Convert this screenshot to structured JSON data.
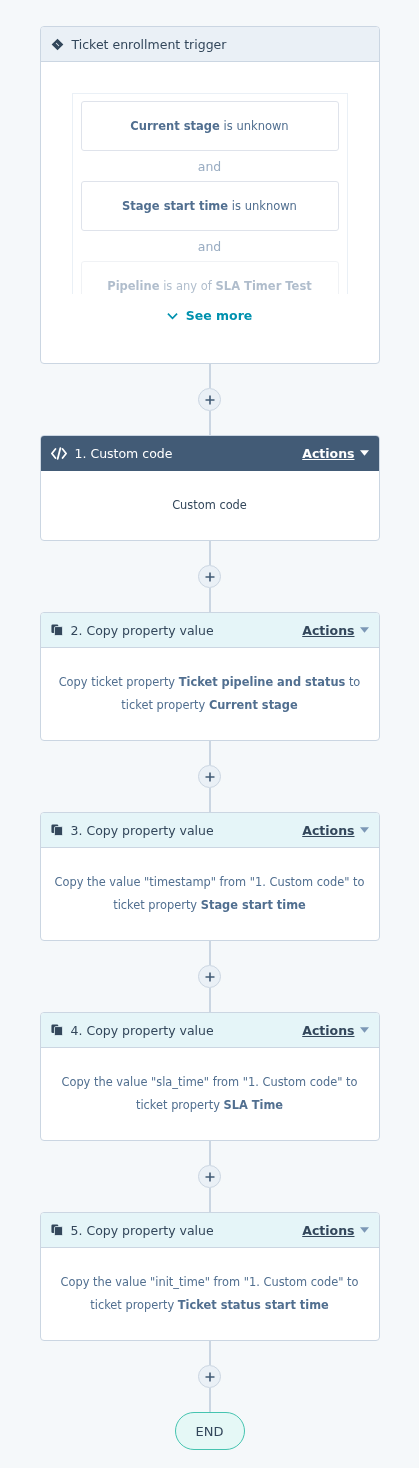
{
  "trigger": {
    "title": "Ticket enrollment trigger",
    "conditions": [
      {
        "text": "**Current stage** is unknown"
      },
      {
        "text": "**Stage start time** is unknown"
      },
      {
        "text": "**Pipeline** is any of **SLA Timer Test**"
      }
    ],
    "joiners": [
      "and",
      "and"
    ],
    "see_more": "See more"
  },
  "steps": [
    {
      "kind": "code",
      "title": "1. Custom code",
      "selected": true,
      "actions": "Actions",
      "body": "Custom code"
    },
    {
      "kind": "copy",
      "title": "2. Copy property value",
      "selected": false,
      "actions": "Actions",
      "body": "Copy ticket property **Ticket pipeline and status** to ticket property **Current stage**"
    },
    {
      "kind": "copy",
      "title": "3. Copy property value",
      "selected": false,
      "actions": "Actions",
      "body": "Copy the value \"timestamp\" from \"1. Custom code\" to ticket property **Stage start time**"
    },
    {
      "kind": "copy",
      "title": "4. Copy property value",
      "selected": false,
      "actions": "Actions",
      "body": "Copy the value \"sla_time\" from \"1. Custom code\" to ticket property **SLA Time**"
    },
    {
      "kind": "copy",
      "title": "5. Copy property value",
      "selected": false,
      "actions": "Actions",
      "body": "Copy the value \"init_time\" from \"1. Custom code\" to ticket property **Ticket status start time**"
    }
  ],
  "end": "END"
}
